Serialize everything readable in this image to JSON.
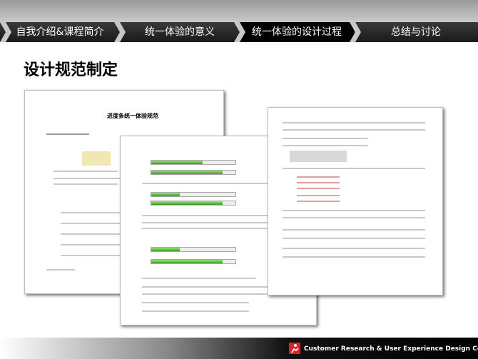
{
  "nav": {
    "tabs": [
      {
        "label": "自我介绍&课程简介",
        "active": false
      },
      {
        "label": "统一体验的意义",
        "active": false
      },
      {
        "label": "统一体验的设计过程",
        "active": true
      },
      {
        "label": "总结与讨论",
        "active": false
      }
    ]
  },
  "page_title": "设计规范制定",
  "doc_left": {
    "heading": "进度条统一体验规范"
  },
  "footer": {
    "text": "Customer Research & User Experience Design Center",
    "logo_icon": "runner-logo-icon"
  },
  "colors": {
    "accent_red": "#cc0000",
    "progress_green": "#3a9a2a"
  }
}
